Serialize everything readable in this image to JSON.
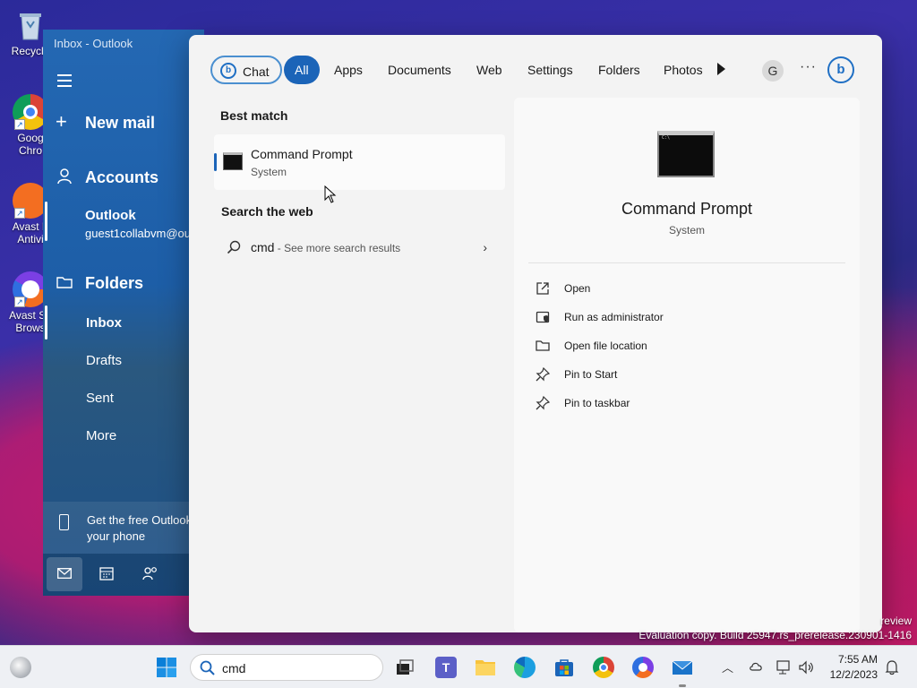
{
  "desktop": {
    "icons": [
      {
        "label": "Recycle",
        "icon": "recycle-bin-icon"
      },
      {
        "label": "Goog Chro",
        "icon": "chrome-icon"
      },
      {
        "label": "Avast F Antivi",
        "icon": "avast-antivirus-icon"
      },
      {
        "label": "Avast Se Brows",
        "icon": "avast-browser-icon"
      }
    ],
    "watermark_line1": "review",
    "watermark_line2": "Evaluation copy. Build 25947.rs_prerelease.230901-1416"
  },
  "outlook": {
    "title": "Inbox - Outlook",
    "new_mail": "New mail",
    "accounts": "Accounts",
    "account_name": "Outlook",
    "account_email": "guest1collabvm@ou",
    "folders": "Folders",
    "folder_items": [
      "Inbox",
      "Drafts",
      "Sent",
      "More"
    ],
    "promo_line1": "Get the free Outlook",
    "promo_line2": "your phone"
  },
  "search": {
    "tabs": [
      "Chat",
      "All",
      "Apps",
      "Documents",
      "Web",
      "Settings",
      "Folders",
      "Photos"
    ],
    "active_tab": "All",
    "avatar_letter": "G",
    "more_label": "···",
    "best_match_heading": "Best match",
    "best_match": {
      "title": "Command Prompt",
      "subtitle": "System"
    },
    "web_heading": "Search the web",
    "web_query": "cmd",
    "web_suffix": " - See more search results",
    "preview": {
      "title": "Command Prompt",
      "subtitle": "System",
      "actions": [
        {
          "label": "Open",
          "icon": "open-external-icon"
        },
        {
          "label": "Run as administrator",
          "icon": "shield-admin-icon"
        },
        {
          "label": "Open file location",
          "icon": "folder-icon"
        },
        {
          "label": "Pin to Start",
          "icon": "pin-icon"
        },
        {
          "label": "Pin to taskbar",
          "icon": "pin-icon"
        }
      ]
    }
  },
  "taskbar": {
    "search_value": "cmd",
    "time": "7:55 AM",
    "date": "12/2/2023"
  },
  "colors": {
    "accent": "#1b64b8",
    "outlook_blue": "#1f5fa8",
    "panel_bg": "#f3f3f3"
  }
}
